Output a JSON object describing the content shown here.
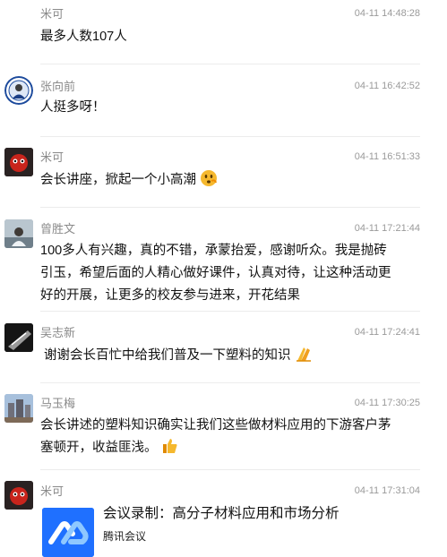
{
  "messages": [
    {
      "name": "米可",
      "time": "04-11 14:48:28",
      "text": "最多人数107人"
    },
    {
      "name": "张向前",
      "time": "04-11 16:42:52",
      "text": "人挺多呀！"
    },
    {
      "name": "米可",
      "time": "04-11 16:51:33",
      "text": "会长讲座，掀起一个小高潮",
      "emoji": "excited-face-icon"
    },
    {
      "name": "曾胜文",
      "time": "04-11 17:21:44",
      "text": "100多人有兴趣，真的不错，承蒙抬爱，感谢听众。我是抛砖引玉，希望后面的人精心做好课件，认真对待，让这种活动更好的开展，让更多的校友参与进来，开花结果"
    },
    {
      "name": "吴志新",
      "time": "04-11 17:24:41",
      "text": "谢谢会长百忙中给我们普及一下塑料的知识",
      "emoji": "praying-hands-icon"
    },
    {
      "name": "马玉梅",
      "time": "04-11 17:30:25",
      "text": "会长讲述的塑料知识确实让我们这些做材料应用的下游客户茅塞顿开，收益匪浅。",
      "emoji": "thumbs-up-icon"
    },
    {
      "name": "米可",
      "time": "04-11 17:31:04",
      "card": {
        "title": "会议录制：高分子材料应用和市场分析",
        "source": "腾讯会议",
        "logo": "tencent-meeting-logo-icon"
      }
    }
  ]
}
